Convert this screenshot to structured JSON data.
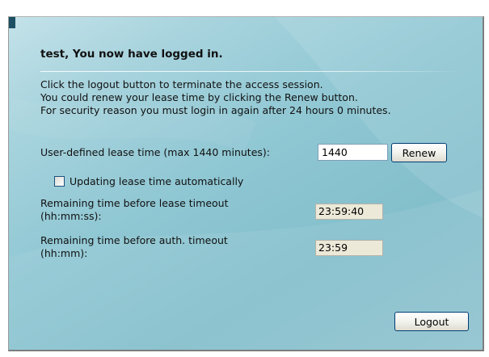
{
  "header": {
    "title": "test, You now have logged in."
  },
  "message_lines": [
    "Click the logout button to terminate the access session.",
    "You could renew your lease time by clicking the Renew button.",
    "For security reason you must login in again after 24 hours 0 minutes."
  ],
  "lease": {
    "label": "User-defined lease time (max 1440 minutes):",
    "value": "1440",
    "renew_label": "Renew"
  },
  "auto_update": {
    "label": "Updating lease time automatically",
    "checked": false
  },
  "lease_timeout": {
    "label_lines": [
      "Remaining time before lease timeout",
      "(hh:mm:ss):"
    ],
    "value": "23:59:40"
  },
  "auth_timeout": {
    "label_lines": [
      "Remaining time before auth. timeout",
      "(hh:mm):"
    ],
    "value": "23:59"
  },
  "logout_label": "Logout",
  "colors": {
    "background": "#8fc7d3",
    "button_border": "#003c74",
    "readout_background": "#ece9d8"
  }
}
